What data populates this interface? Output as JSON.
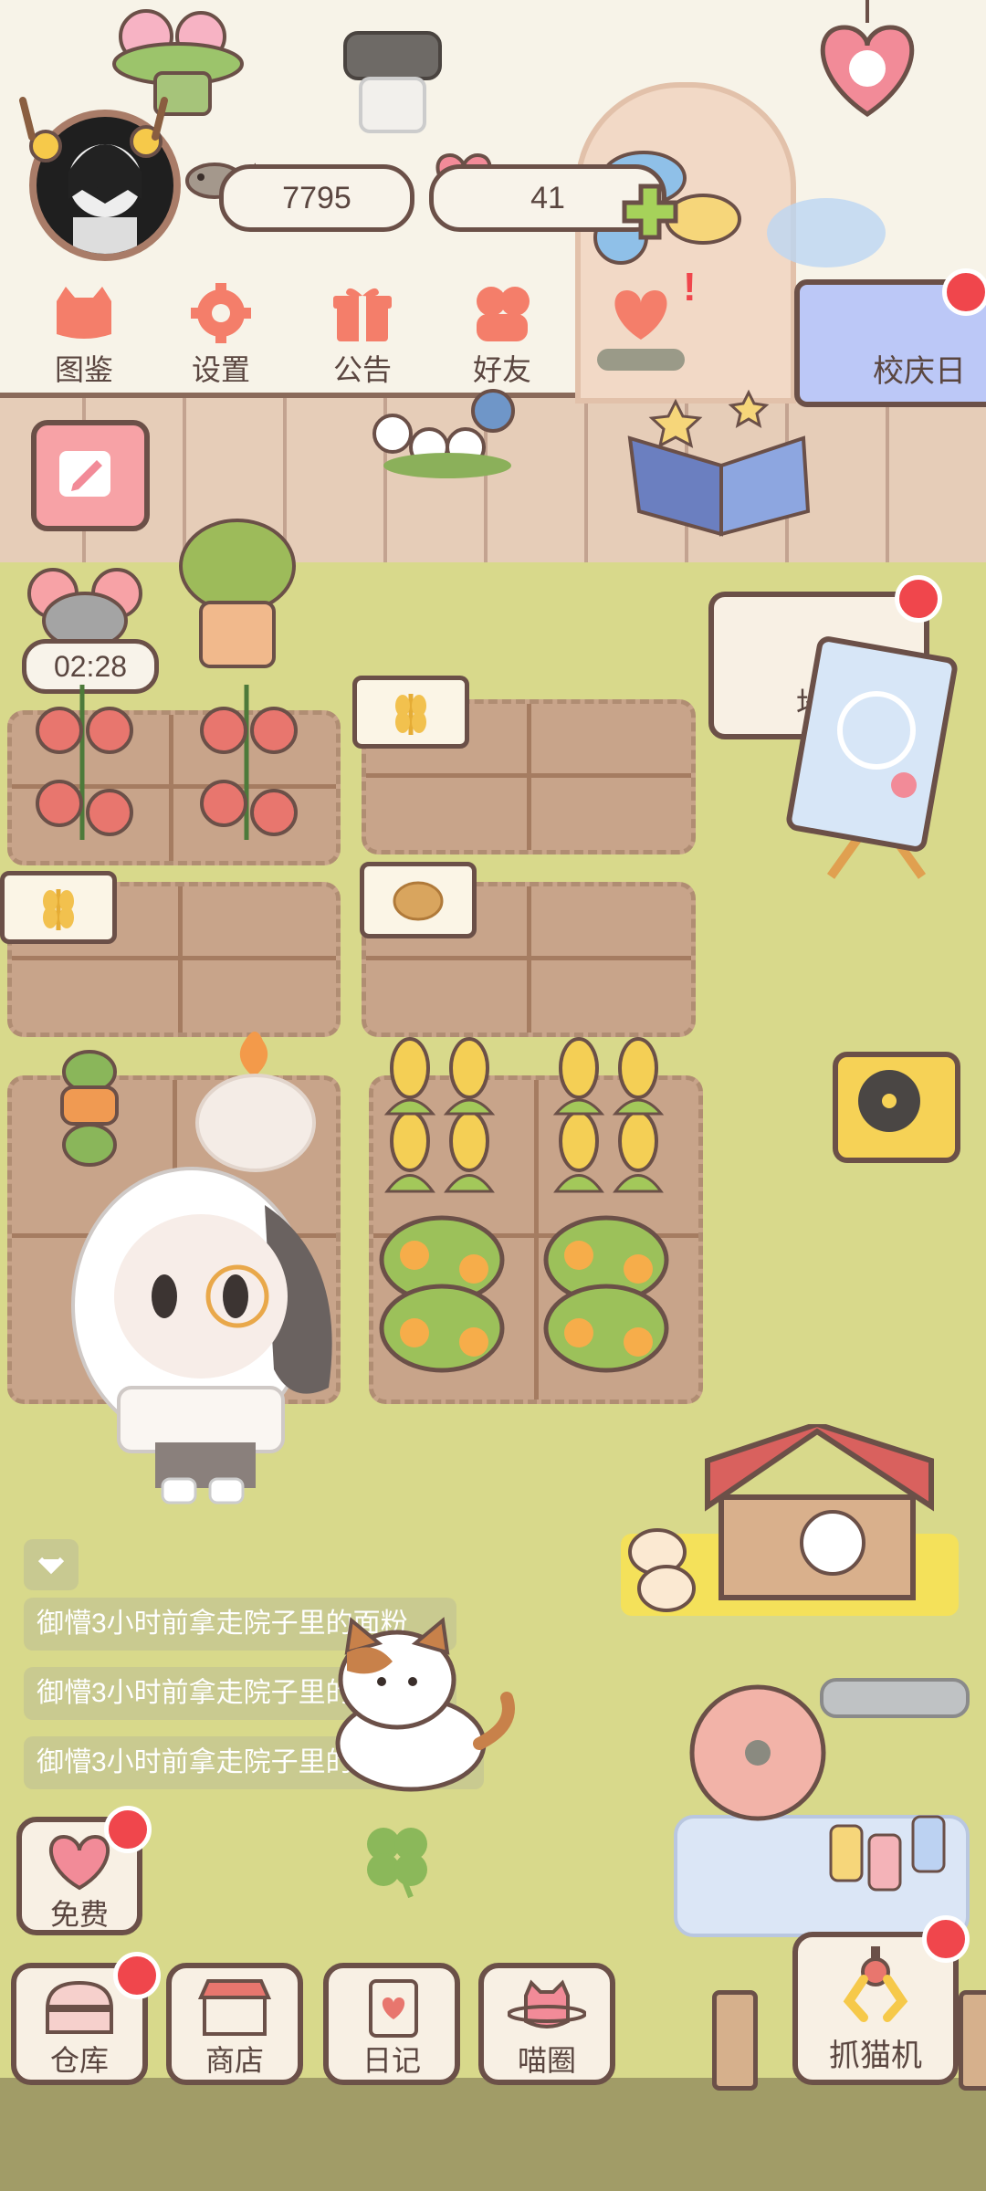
{
  "header": {
    "fish_count": "7795",
    "heart_count": "41"
  },
  "top_menu": [
    {
      "label": "图鉴",
      "icon": "cat-book-icon"
    },
    {
      "label": "设置",
      "icon": "gear-icon"
    },
    {
      "label": "公告",
      "icon": "gift-icon"
    },
    {
      "label": "好友",
      "icon": "friends-icon"
    },
    {
      "label": "",
      "icon": "heart-mail-icon"
    }
  ],
  "event_banner": {
    "label": "校庆日"
  },
  "timer": {
    "value": "02:28"
  },
  "map_sign": {
    "label": "地"
  },
  "messages": [
    "御懵3小时前拿走院子里的面粉",
    "御懵3小时前拿走院子里的芒果",
    "御懵3小时前拿走院子里的胡萝卜"
  ],
  "free_button": {
    "label": "免费"
  },
  "bottom_nav": [
    {
      "label": "仓库",
      "icon": "warehouse-icon"
    },
    {
      "label": "商店",
      "icon": "shop-icon"
    },
    {
      "label": "日记",
      "icon": "diary-icon"
    },
    {
      "label": "喵圈",
      "icon": "cat-planet-icon"
    }
  ],
  "claw_machine": {
    "label": "抓猫机"
  },
  "colors": {
    "accent_red": "#f0464c",
    "outline": "#6b5048",
    "lawn": "#d8d98b",
    "plot": "#c8a48a"
  }
}
